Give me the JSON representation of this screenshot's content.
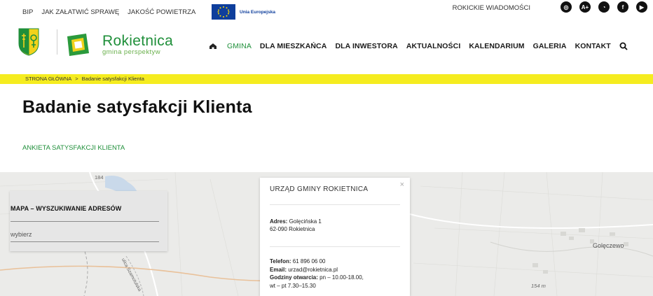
{
  "top_links": [
    "BIP",
    "JAK ZAŁATWIĆ SPRAWĘ",
    "JAKOŚĆ POWIETRZA"
  ],
  "eu_label": "Unia Europejska",
  "news_label": "ROKICKIE WIADOMOŚCI",
  "socials": [
    {
      "icon": "instagram-icon",
      "glyph": "◎"
    },
    {
      "icon": "accessibility-icon",
      "glyph": "A+"
    },
    {
      "icon": "rss-icon",
      "glyph": "◔"
    },
    {
      "icon": "facebook-icon",
      "glyph": "f"
    },
    {
      "icon": "youtube-icon",
      "glyph": "▶"
    }
  ],
  "brand": {
    "name": "Rokietnica",
    "tagline": "gmina perspektyw"
  },
  "nav": [
    "GMINA",
    "DLA MIESZKAŃCA",
    "DLA INWESTORA",
    "AKTUALNOŚCI",
    "KALENDARIUM",
    "GALERIA",
    "KONTAKT"
  ],
  "breadcrumb": {
    "home": "STRONA GŁÓWNA",
    "sep": ">",
    "current": "Badanie satysfakcji Klienta"
  },
  "page_title": "Badanie satysfakcji Klienta",
  "survey_link": "ANKIETA SATYSFAKCJI KLIENTA",
  "map": {
    "road_tag": "184",
    "place_label": "Golęczewo",
    "elevation": "154 m",
    "street_label": "ulica Szamotulska"
  },
  "search_panel": {
    "title": "MAPA – WYSZUKIWANIE ADRESÓW",
    "value": "wybierz"
  },
  "popup": {
    "title": "URZĄD GMINY ROKIETNICA",
    "address_label": "Adres:",
    "address_line1": "Golęcińska 1",
    "address_line2": "62-090 Rokietnica",
    "phone_label": "Telefon:",
    "phone": "61 896 06 00",
    "email_label": "Email:",
    "email": "urzad@rokietnica.pl",
    "hours_label": "Godziny otwarcia:",
    "hours_line1": "pn – 10.00-18.00,",
    "hours_line2": "wt – pt 7.30–15.30"
  },
  "colors": {
    "accent_green": "#1f8f3a",
    "breadcrumb_yellow": "#f5ec1f",
    "eu_blue": "#0e3e9c"
  }
}
